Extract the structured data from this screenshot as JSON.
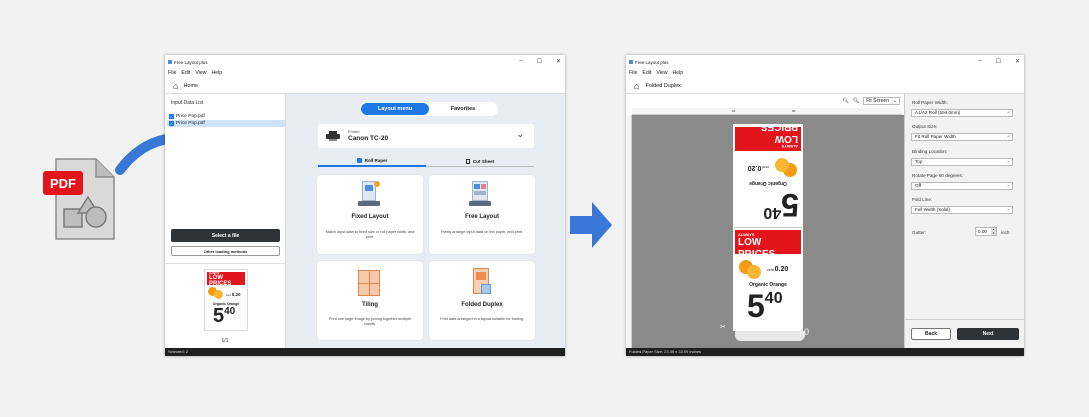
{
  "pdf_badge": "PDF",
  "colors": {
    "arrow_blue": "#3a78d8",
    "accent_blue": "#1e78e6",
    "red": "#e3141b",
    "dark": "#2f3236"
  },
  "left_window": {
    "title": "Free Layout plus",
    "menu": [
      "File",
      "Edit",
      "View",
      "Help"
    ],
    "home_label": "Home",
    "input_list_title": "Input Data List",
    "files": [
      {
        "name": "Price Pop.pdf"
      },
      {
        "name": "Price Pop.pdf"
      }
    ],
    "select_file_btn": "Select a file",
    "other_methods_btn": "Other loading methods",
    "page_indicator": "1/1",
    "status": "Selected: 2",
    "tabs": [
      "Layout menu",
      "Favorites"
    ],
    "printer": {
      "label": "Printer",
      "name": "Canon TC-20"
    },
    "media_tabs": [
      "Roll Paper",
      "Cut Sheet"
    ],
    "cards": [
      {
        "title": "Fixed Layout",
        "desc": "Match input data to fixed size or roll paper width, and print."
      },
      {
        "title": "Free Layout",
        "desc": "Freely arrange input data on the paper, and print."
      },
      {
        "title": "Tiling",
        "desc": "Print one large image by joining together multiple sheets."
      },
      {
        "title": "Folded Duplex",
        "desc": "Print data arranged in a layout suitable for folding."
      }
    ],
    "thumb": {
      "always": "ALWAYS",
      "low_prices": "LOW PRICES",
      "price_small": "0.20",
      "cent": "cent",
      "item": "Organic Orange",
      "big": "5",
      "big_sup": "40"
    }
  },
  "right_window": {
    "title": "Free Layout plus",
    "menu": [
      "File",
      "Edit",
      "View",
      "Help"
    ],
    "mode_label": "Folded Duplex",
    "zoom_label": "Fit Screen",
    "fields": [
      {
        "label": "Roll Paper Width:",
        "value": "A1/A2 Roll (594.0mm)"
      },
      {
        "label": "Output Size:",
        "value": "Fit Roll Paper Width"
      },
      {
        "label": "Binding Location:",
        "value": "Top"
      },
      {
        "label": "Rotate Page 90 degrees:",
        "value": "Off"
      },
      {
        "label": "Fold Line:",
        "value": "Full Width (Solid)"
      }
    ],
    "gutter": {
      "label": "Gutter:",
      "value": "0.00",
      "unit": "inch"
    },
    "back_btn": "Back",
    "next_btn": "Next",
    "status": "Folded Paper Size: 23.39 x 33.09 inches",
    "ruler_marks": [
      "10",
      "20"
    ],
    "page_num": "0"
  }
}
